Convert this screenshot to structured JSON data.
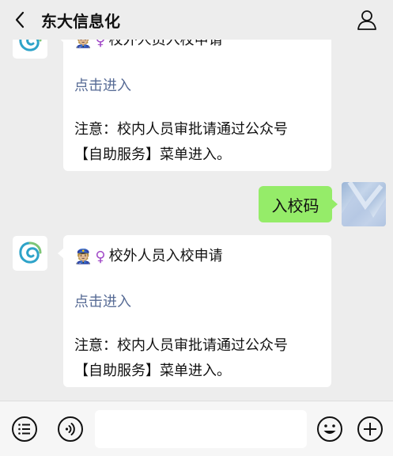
{
  "header": {
    "title": "东大信息化",
    "back_icon": "chevron-left-icon",
    "profile_icon": "person-icon"
  },
  "messages": [
    {
      "sender": "official",
      "card_title": "校外人员入校申请",
      "link_text": "点击进入",
      "note_line1": "注意：校内人员审批请通过公众号",
      "note_line2": "【自助服务】菜单进入。"
    },
    {
      "sender": "user",
      "text": "入校码"
    },
    {
      "sender": "official",
      "card_title": "校外人员入校申请",
      "link_text": "点击进入",
      "note_line1": "注意：校内人员审批请通过公众号",
      "note_line2": "【自助服务】菜单进入。"
    }
  ],
  "emoji": {
    "police": "👮🏼",
    "female": "♀"
  },
  "toolbar": {
    "menu_icon": "list-circle-icon",
    "voice_icon": "voice-icon",
    "input_value": "",
    "emoji_icon": "smiley-icon",
    "plus_icon": "plus-circle-icon"
  },
  "colors": {
    "background": "#ededed",
    "user_bubble": "#95ec69",
    "link": "#576b95"
  }
}
